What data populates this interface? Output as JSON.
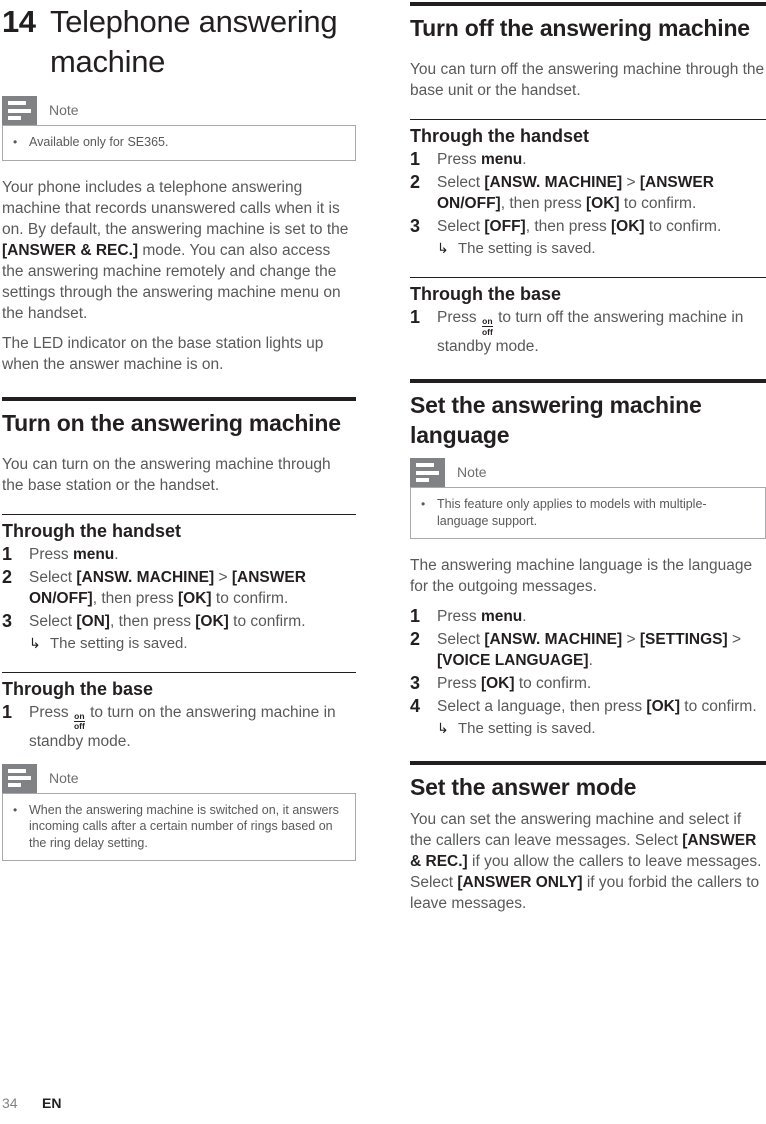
{
  "chapter": {
    "number": "14",
    "title": "Telephone answering machine"
  },
  "note_label": "Note",
  "footer": {
    "page_number": "34",
    "language": "EN"
  },
  "left_column": {
    "note_top": "Available only for SE365.",
    "intro_paragraph_1_a": "Your phone includes a telephone answering machine that records unanswered calls when it is on. By default, the answering machine is set to the ",
    "intro_paragraph_1_key": "[ANSWER & REC.]",
    "intro_paragraph_1_b": " mode. You can also access the answering machine remotely and change the settings through the answering machine menu on the handset.",
    "intro_paragraph_2": "The LED indicator on the base station lights up when the answer machine is on.",
    "section_title": "Turn on the answering machine",
    "section_intro": "You can turn on the answering machine through the base station or the handset.",
    "handset_heading": "Through the handset",
    "handset_steps": [
      {
        "num": "1",
        "parts": [
          {
            "t": "Press ",
            "b": false
          },
          {
            "t": "menu",
            "b": true
          },
          {
            "t": ".",
            "b": false
          }
        ]
      },
      {
        "num": "2",
        "parts": [
          {
            "t": "Select ",
            "b": false
          },
          {
            "t": "[ANSW. MACHINE]",
            "b": true
          },
          {
            "t": " > ",
            "b": false
          },
          {
            "t": "[ANSWER ON/OFF]",
            "b": true
          },
          {
            "t": ", then press ",
            "b": false
          },
          {
            "t": "[OK]",
            "b": true
          },
          {
            "t": " to confirm.",
            "b": false
          }
        ]
      },
      {
        "num": "3",
        "parts": [
          {
            "t": "Select ",
            "b": false
          },
          {
            "t": "[ON]",
            "b": true
          },
          {
            "t": ", then press ",
            "b": false
          },
          {
            "t": "[OK]",
            "b": true
          },
          {
            "t": " to confirm.",
            "b": false
          }
        ],
        "result": "The setting is saved."
      }
    ],
    "base_heading": "Through the base",
    "base_step": {
      "num": "1",
      "before": "Press ",
      "key_on": "on",
      "key_off": "off",
      "after": " to turn on the answering machine in standby mode."
    },
    "note_bottom": "When the answering machine is switched on, it answers incoming calls after a certain number of rings based on the ring delay setting."
  },
  "right_column": {
    "section_title_off": "Turn off the answering machine",
    "section_intro_off": "You can turn off the answering machine through the base unit or the handset.",
    "handset_heading": "Through the handset",
    "handset_steps": [
      {
        "num": "1",
        "parts": [
          {
            "t": "Press ",
            "b": false
          },
          {
            "t": "menu",
            "b": true
          },
          {
            "t": ".",
            "b": false
          }
        ]
      },
      {
        "num": "2",
        "parts": [
          {
            "t": "Select ",
            "b": false
          },
          {
            "t": "[ANSW. MACHINE]",
            "b": true
          },
          {
            "t": " > ",
            "b": false
          },
          {
            "t": "[ANSWER ON/OFF]",
            "b": true
          },
          {
            "t": ", then press ",
            "b": false
          },
          {
            "t": "[OK]",
            "b": true
          },
          {
            "t": " to confirm.",
            "b": false
          }
        ]
      },
      {
        "num": "3",
        "parts": [
          {
            "t": "Select ",
            "b": false
          },
          {
            "t": "[OFF]",
            "b": true
          },
          {
            "t": ", then press ",
            "b": false
          },
          {
            "t": "[OK]",
            "b": true
          },
          {
            "t": " to confirm.",
            "b": false
          }
        ],
        "result": "The setting is saved."
      }
    ],
    "base_heading": "Through the base",
    "base_step": {
      "num": "1",
      "before": "Press ",
      "key_on": "on",
      "key_off": "off",
      "after": " to turn off the answering machine in standby mode."
    },
    "section_title_language": "Set the answering machine language",
    "note_language": "This feature only applies to models with multiple-language support.",
    "language_intro": "The answering machine language is the language for the outgoing messages.",
    "language_steps": [
      {
        "num": "1",
        "parts": [
          {
            "t": "Press ",
            "b": false
          },
          {
            "t": "menu",
            "b": true
          },
          {
            "t": ".",
            "b": false
          }
        ]
      },
      {
        "num": "2",
        "parts": [
          {
            "t": "Select ",
            "b": false
          },
          {
            "t": "[ANSW. MACHINE]",
            "b": true
          },
          {
            "t": " > ",
            "b": false
          },
          {
            "t": "[SETTINGS]",
            "b": true
          },
          {
            "t": " > ",
            "b": false
          },
          {
            "t": "[VOICE LANGUAGE]",
            "b": true
          },
          {
            "t": ".",
            "b": false
          }
        ]
      },
      {
        "num": "3",
        "parts": [
          {
            "t": "Press ",
            "b": false
          },
          {
            "t": "[OK]",
            "b": true
          },
          {
            "t": " to confirm.",
            "b": false
          }
        ]
      },
      {
        "num": "4",
        "parts": [
          {
            "t": "Select a language, then press ",
            "b": false
          },
          {
            "t": "[OK]",
            "b": true
          },
          {
            "t": " to confirm.",
            "b": false
          }
        ],
        "result": "The setting is saved."
      }
    ],
    "section_title_mode": "Set the answer mode",
    "mode_paragraph": [
      {
        "t": "You can set the answering machine and select if the callers can leave messages. Select ",
        "b": false
      },
      {
        "t": "[ANSWER & REC.]",
        "b": true
      },
      {
        "t": " if you allow the callers to leave messages. Select ",
        "b": false
      },
      {
        "t": "[ANSWER ONLY]",
        "b": true
      },
      {
        "t": " if you forbid the callers to leave messages.",
        "b": false
      }
    ]
  },
  "icons": {
    "note": "note-icon",
    "result_arrow": "↳",
    "bullet": "•"
  }
}
